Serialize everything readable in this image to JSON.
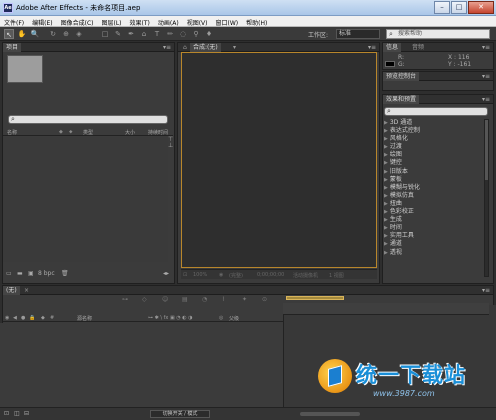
{
  "window": {
    "title": "Adobe After Effects - 未命名项目.aep",
    "app_icon": "Ae"
  },
  "window_buttons": {
    "minimize": "–",
    "maximize": "□",
    "close": "✕"
  },
  "menu": [
    "文件(F)",
    "编辑(E)",
    "图像合成(C)",
    "图层(L)",
    "效果(T)",
    "动画(A)",
    "视图(V)",
    "窗口(W)",
    "帮助(H)"
  ],
  "toolbar": {
    "tools": [
      "↖",
      "✋",
      "🔍",
      "↻",
      "⊕",
      "◈",
      "□",
      "✎",
      "✒",
      "⌂",
      "T",
      "✏",
      "◌",
      "⚲",
      "♦"
    ],
    "workspace_label": "工作区:",
    "workspace_value": "标准",
    "search_placeholder": "搜索帮助"
  },
  "project_panel": {
    "tab": "项目",
    "columns": {
      "name": "名称",
      "type": "类型",
      "size": "大小",
      "duration": "持续时间"
    },
    "footer_bpc": "8 bpc"
  },
  "comp_panel": {
    "tab": "合成:(无)",
    "controls": [
      "100%",
      "(完整)",
      "0;00;00;00",
      "活动摄像机",
      "1 视图"
    ]
  },
  "info_panel": {
    "tabs": [
      "信息",
      "音频"
    ],
    "r_label": "R:",
    "g_label": "G:",
    "x_value": "X : 116",
    "y_value": "Y : -161"
  },
  "preview_panel": {
    "tab": "预览控制台"
  },
  "effects_panel": {
    "tab": "效果和预置",
    "items": [
      "3D 通道",
      "表达式控制",
      "风格化",
      "过渡",
      "绘图",
      "键控",
      "旧版本",
      "蒙板",
      "模糊与锐化",
      "模拟仿真",
      "扭曲",
      "色彩校正",
      "生成",
      "时间",
      "实用工具",
      "通道",
      "透视"
    ]
  },
  "timeline_panel": {
    "tab": "(无)",
    "columns": {
      "source_name": "源名称",
      "parent": "父级"
    },
    "switch_button": "切换开关 / 模式"
  },
  "watermark": {
    "text": "统一下载站",
    "url": "www.3987.com"
  }
}
